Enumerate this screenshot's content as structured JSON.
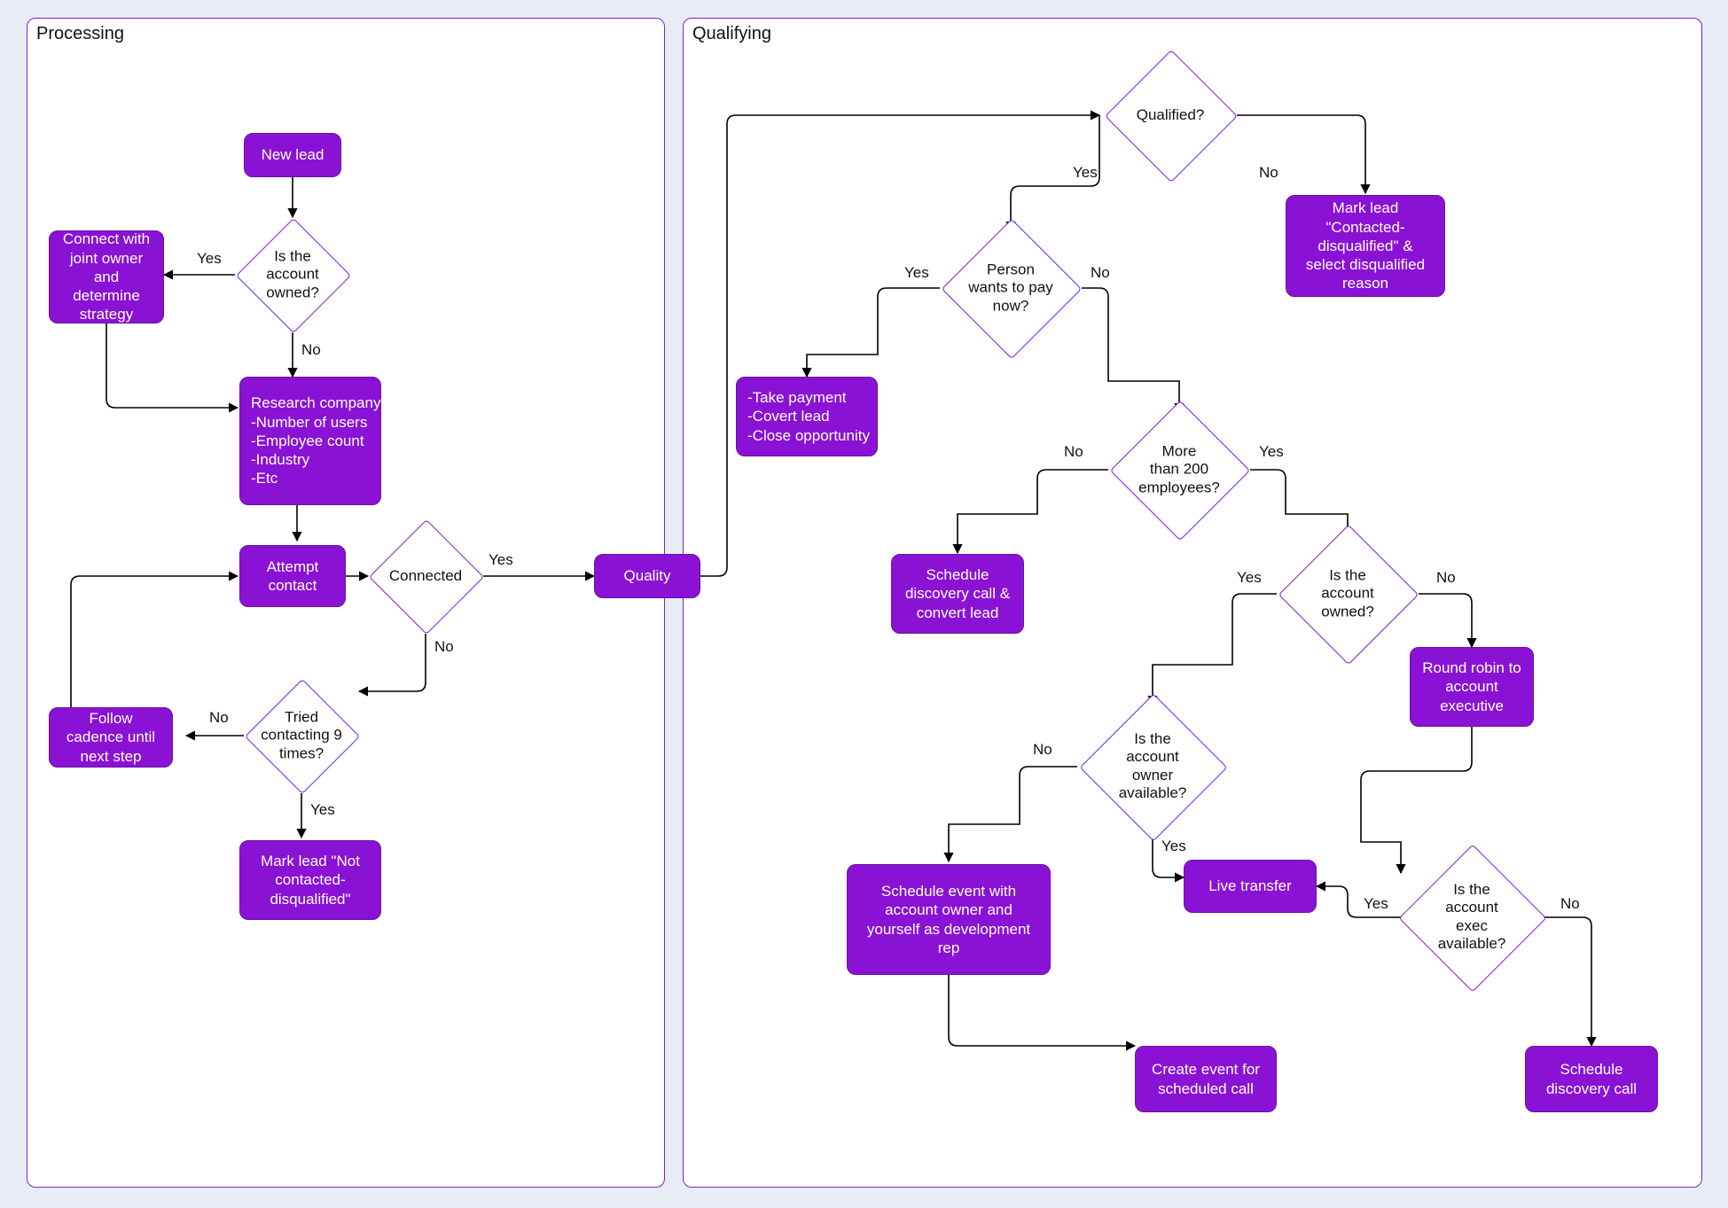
{
  "groups": {
    "processing": "Processing",
    "qualifying": "Qualifying"
  },
  "nodes": {
    "newLead": "New lead",
    "connectJoint": "Connect with joint owner and determine strategy",
    "research": "Research company:\n-Number of users\n-Employee count\n-Industry\n-Etc",
    "attempt": "Attempt contact",
    "followCadence": "Follow cadence until next step",
    "markNotContacted": "Mark lead \"Not contacted-disqualified\"",
    "quality": "Quality",
    "markContactedDisq": "Mark lead \"Contacted-disqualified\" & select disqualified reason",
    "takePayment": "-Take payment\n-Covert lead\n-Close opportunity",
    "scheduleDiscoveryConvert": "Schedule discovery call & convert lead",
    "roundRobin": "Round robin to account executive",
    "scheduleEventOwner": "Schedule event with account owner and yourself as development rep",
    "liveTransfer": "Live transfer",
    "scheduleDiscovery": "Schedule discovery call",
    "createEvent": "Create event for scheduled call"
  },
  "decisions": {
    "accountOwned1": "Is the\naccount\nowned?",
    "connected": "Connected",
    "tried9": "Tried\ncontacting 9\ntimes?",
    "qualified": "Qualified?",
    "payNow": "Person\nwants to pay\nnow?",
    "employees200": "More\nthan 200\nemployees?",
    "accountOwned2": "Is the\naccount\nowned?",
    "ownerAvail": "Is the\naccount\nowner\navailable?",
    "execAvail": "Is the\naccount\nexec\navailable?"
  },
  "labels": {
    "yes": "Yes",
    "no": "No"
  }
}
